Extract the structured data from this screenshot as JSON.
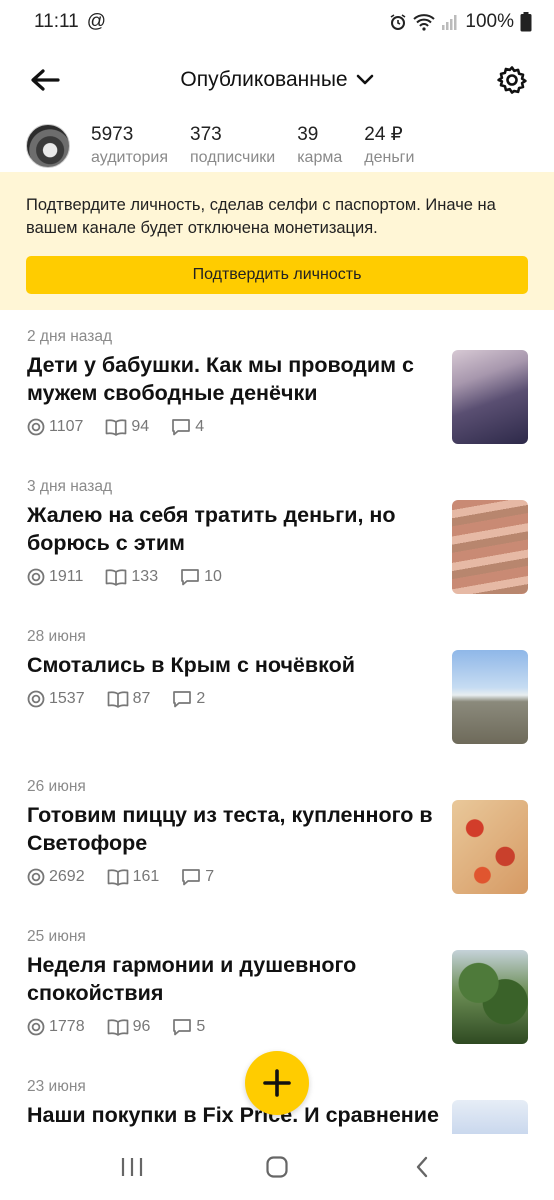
{
  "status_bar": {
    "time": "11:11",
    "battery": "100%"
  },
  "header": {
    "title": "Опубликованные"
  },
  "stats": [
    {
      "value": "5973",
      "label": "аудитория"
    },
    {
      "value": "373",
      "label": "подписчики"
    },
    {
      "value": "39",
      "label": "карма"
    },
    {
      "value": "24 ₽",
      "label": "деньги"
    }
  ],
  "banner": {
    "text": "Подтвердите личность, сделав селфи с паспортом. Иначе на вашем канале будет отключена монетизация.",
    "button_label": "Подтвердить личность"
  },
  "posts": [
    {
      "date": "2 дня назад",
      "title": "Дети у бабушки. Как мы проводим с мужем свободные денёчки",
      "views": "1107",
      "reads": "94",
      "comments": "4"
    },
    {
      "date": "3 дня назад",
      "title": "Жалею на себя тратить деньги, но борюсь с этим",
      "views": "1911",
      "reads": "133",
      "comments": "10"
    },
    {
      "date": "28 июня",
      "title": "Смотались в Крым с ночёвкой",
      "views": "1537",
      "reads": "87",
      "comments": "2"
    },
    {
      "date": "26 июня",
      "title": "Готовим пиццу из теста, купленного в Светофоре",
      "views": "2692",
      "reads": "161",
      "comments": "7"
    },
    {
      "date": "25 июня",
      "title": "Неделя гармонии и душевного спокойствия",
      "views": "1778",
      "reads": "96",
      "comments": "5"
    },
    {
      "date": "23 июня",
      "title": "Наши покупки в Fix Price. И сравнение некоторых цен с",
      "views": "",
      "reads": "",
      "comments": ""
    }
  ],
  "icons": {
    "back": "arrow-left-icon",
    "dropdown": "chevron-down-icon",
    "settings": "gear-icon",
    "views": "eye-icon",
    "reads": "book-icon",
    "comments": "comment-icon",
    "add": "plus-icon"
  },
  "colors": {
    "accent": "#ffcc00",
    "banner_bg": "#fff6d6"
  }
}
